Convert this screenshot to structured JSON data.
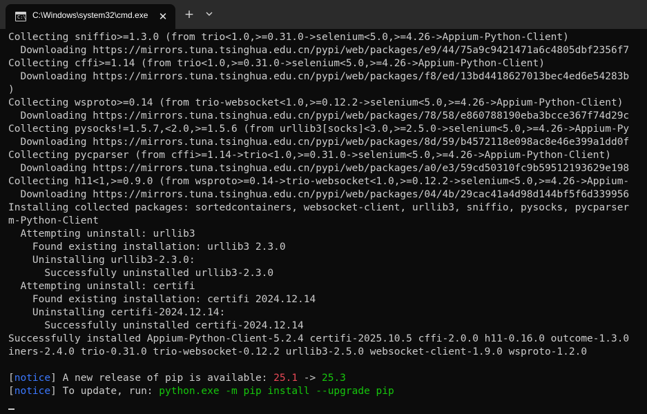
{
  "window": {
    "tab_title": "C:\\Windows\\system32\\cmd.exe",
    "tab_icon_label": "C:\\",
    "close_glyph": "✕",
    "new_tab_glyph": "+"
  },
  "terminal": {
    "lines": [
      "Collecting sniffio>=1.3.0 (from trio<1.0,>=0.31.0->selenium<5.0,>=4.26->Appium-Python-Client)",
      "  Downloading https://mirrors.tuna.tsinghua.edu.cn/pypi/web/packages/e9/44/75a9c9421471a6c4805dbf2356f7",
      "Collecting cffi>=1.14 (from trio<1.0,>=0.31.0->selenium<5.0,>=4.26->Appium-Python-Client)",
      "  Downloading https://mirrors.tuna.tsinghua.edu.cn/pypi/web/packages/f8/ed/13bd4418627013bec4ed6e54283b",
      ")",
      "Collecting wsproto>=0.14 (from trio-websocket<1.0,>=0.12.2->selenium<5.0,>=4.26->Appium-Python-Client)",
      "  Downloading https://mirrors.tuna.tsinghua.edu.cn/pypi/web/packages/78/58/e860788190eba3bcce367f74d29c",
      "Collecting pysocks!=1.5.7,<2.0,>=1.5.6 (from urllib3[socks]<3.0,>=2.5.0->selenium<5.0,>=4.26->Appium-Py",
      "  Downloading https://mirrors.tuna.tsinghua.edu.cn/pypi/web/packages/8d/59/b4572118e098ac8e46e399a1dd0f",
      "Collecting pycparser (from cffi>=1.14->trio<1.0,>=0.31.0->selenium<5.0,>=4.26->Appium-Python-Client)",
      "  Downloading https://mirrors.tuna.tsinghua.edu.cn/pypi/web/packages/a0/e3/59cd50310fc9b59512193629e198",
      "Collecting h11<1,>=0.9.0 (from wsproto>=0.14->trio-websocket<1.0,>=0.12.2->selenium<5.0,>=4.26->Appium-",
      "  Downloading https://mirrors.tuna.tsinghua.edu.cn/pypi/web/packages/04/4b/29cac41a4d98d144bf5f6d339956",
      "Installing collected packages: sortedcontainers, websocket-client, urllib3, sniffio, pysocks, pycparser",
      "m-Python-Client",
      "  Attempting uninstall: urllib3",
      "    Found existing installation: urllib3 2.3.0",
      "    Uninstalling urllib3-2.3.0:",
      "      Successfully uninstalled urllib3-2.3.0",
      "  Attempting uninstall: certifi",
      "    Found existing installation: certifi 2024.12.14",
      "    Uninstalling certifi-2024.12.14:",
      "      Successfully uninstalled certifi-2024.12.14",
      "Successfully installed Appium-Python-Client-5.2.4 certifi-2025.10.5 cffi-2.0.0 h11-0.16.0 outcome-1.3.0",
      "iners-2.4.0 trio-0.31.0 trio-websocket-0.12.2 urllib3-2.5.0 websocket-client-1.9.0 wsproto-1.2.0",
      ""
    ],
    "notice_1": {
      "open": "[",
      "tag": "notice",
      "close": "]",
      "text": " A new release of pip is available: ",
      "old_version": "25.1",
      "arrow": " -> ",
      "new_version": "25.3"
    },
    "notice_2": {
      "open": "[",
      "tag": "notice",
      "close": "]",
      "text": " To update, run: ",
      "command": "python.exe -m pip install --upgrade pip"
    },
    "colors": {
      "background": "#0c0c0c",
      "foreground": "#cccccc",
      "notice": "#3b78ff",
      "old_version": "#e74856",
      "new_version": "#16c60c",
      "command": "#16c60c"
    }
  }
}
